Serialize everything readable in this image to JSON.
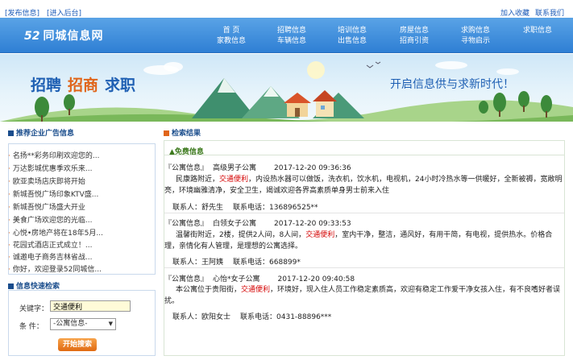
{
  "topbar": {
    "publish": "[发布信息]",
    "admin": "[进入后台]",
    "favorite": "加入收藏",
    "contact": "联系我们"
  },
  "header": {
    "logo_num": "52",
    "logo_text": "同城信息网",
    "nav": [
      [
        "首  页",
        "家教信息"
      ],
      [
        "招聘信息",
        "车辆信息"
      ],
      [
        "培训信息",
        "出售信息"
      ],
      [
        "房屋信息",
        "招商引资"
      ],
      [
        "求购信息",
        "寻物启示"
      ],
      [
        "求职信息",
        ""
      ]
    ]
  },
  "banner": {
    "word1": "招聘",
    "word2": "招商",
    "word3": "求职",
    "slogan": "开启信息供与求新时代！"
  },
  "ads": {
    "title": "推荐企业广告信息",
    "items": [
      "名扬**彩务印刷欢迎您的...",
      "万达影城优惠季欢乐来...",
      "欧亚卖场店庆即将开始",
      "新城吾悦广场印象KTV盛...",
      "新城吾悦广场盛大开业",
      "美食广场欢迎您的光临...",
      "心悦•房地产将在18年5月...",
      "花园式酒店正式成立！...",
      "诚邀电子商务吉林省战...",
      "你好，欢迎登录52同城信..."
    ]
  },
  "search": {
    "title": "信息快速检索",
    "keyword_label": "关键字：",
    "keyword_value": "交通便利",
    "condition_label": "条  件：",
    "condition_value": "-公寓信息-",
    "button": "开始搜索"
  },
  "results": {
    "title": "检索结果",
    "free_title": "▲免费信息",
    "items": [
      {
        "category": "『公寓信息』",
        "name": "高级男子公寓",
        "datetime": "2017-12-20 09:36:36",
        "pre": "民康路附近，",
        "highlight": "交通便利",
        "post": "，内设热水器可以做饭，洗衣机，饮水机，电视机，24小时冷热水等一供暖好，全新被褥，宽敞明亮，环境幽雅清净，安全卫生，竭诚欢迎各界高素质单身男士前来入住",
        "contact_label": "联系人：舒先生",
        "phone_label": "联系电话：136896525**"
      },
      {
        "category": "『公寓信息』",
        "name": "白领女子公寓",
        "datetime": "2017-12-20 09:33:53",
        "pre": "温馨街附近，2楼，提供2人间，8人间，",
        "highlight": "交通便利",
        "post": "，室内干净，整洁，通风好，有用干简，有电视，提供热水。价格合理，亲情化有人管理，是理想的公寓选择。",
        "contact_label": "联系人：王阿姨",
        "phone_label": "联系电话：668899*"
      },
      {
        "category": "『公寓信息』",
        "name": "心怡*女子公寓",
        "datetime": "2017-12-20 09:40:58",
        "pre": "本公寓位于贵阳街，",
        "highlight": "交通便利",
        "post": "，环境好，现入住人员工作稳定素质高，欢迎有稳定工作爱干净女孩入住，有不良嗜好者误扰。",
        "contact_label": "联系人：欧阳女士",
        "phone_label": "联系电话：0431-88896***"
      }
    ]
  },
  "colors": {
    "header_blue": "#2f7fd4",
    "link_blue": "#1d5bb8",
    "accent_orange": "#e0651a",
    "highlight_red": "#d40000"
  }
}
